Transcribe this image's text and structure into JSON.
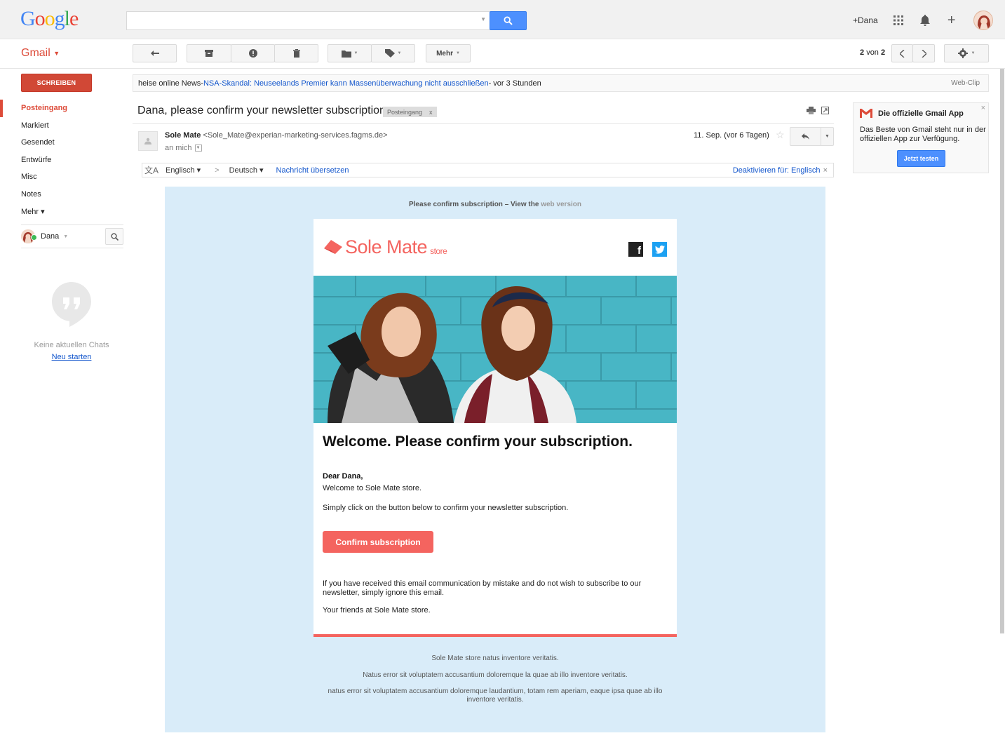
{
  "header": {
    "logo_letters": [
      "G",
      "o",
      "o",
      "g",
      "l",
      "e"
    ],
    "logo_colors": [
      "#4285f4",
      "#ea4335",
      "#fbbc05",
      "#4285f4",
      "#34a853",
      "#ea4335"
    ],
    "search": {
      "value": "",
      "placeholder": ""
    },
    "user_link": "+Dana",
    "icons": [
      "apps-grid-icon",
      "notifications-bell-icon",
      "share-plus-icon",
      "account-avatar"
    ]
  },
  "toolbar": {
    "gmail_label": "Gmail",
    "more_label": "Mehr",
    "pager_current": "2",
    "pager_of": "von",
    "pager_total": "2"
  },
  "sidebar": {
    "compose_label": "SCHREIBEN",
    "items": [
      {
        "label": "Posteingang",
        "active": true
      },
      {
        "label": "Markiert",
        "active": false
      },
      {
        "label": "Gesendet",
        "active": false
      },
      {
        "label": "Entwürfe",
        "active": false
      },
      {
        "label": "Misc",
        "active": false
      },
      {
        "label": "Notes",
        "active": false
      },
      {
        "label": "Mehr ▾",
        "active": false
      }
    ],
    "chat_user": "Dana",
    "no_chats": "Keine aktuellen Chats",
    "new_chat": "Neu starten"
  },
  "webclip": {
    "source": "heise online News",
    "separator": " - ",
    "headline": "NSA-Skandal: Neuseelands Premier kann Massenüberwachung nicht ausschließen",
    "time": " - vor 3 Stunden",
    "label": "Web-Clip"
  },
  "message": {
    "subject": "Dana, please confirm your newsletter subscription",
    "label_chip": "Posteingang",
    "label_remove": "x",
    "sender_name": "Sole Mate",
    "sender_email": "<Sole_Mate@experian-marketing-services.fagms.de>",
    "to": "an mich",
    "date": "11. Sep. (vor 6 Tagen)"
  },
  "translate": {
    "from_lang": "Englisch ▾",
    "arrow": ">",
    "to_lang": "Deutsch ▾",
    "translate_link": "Nachricht übersetzen",
    "disable_link": "Deaktivieren für: Englisch",
    "close": "×"
  },
  "email": {
    "preheader_main": "Please confirm subscription  – View the ",
    "preheader_link": "web version",
    "brand_name": "Sole Mate",
    "brand_suffix": "store",
    "facebook": "f",
    "heading": "Welcome. Please confirm your subscription.",
    "greeting": "Dear Dana,",
    "line1": "Welcome to Sole Mate store.",
    "line2": "Simply click on the button below to confirm your newsletter subscription.",
    "button": "Confirm subscription",
    "line3": "If you have received this email communication by mistake and do not wish to subscribe to our newsletter, simply ignore this email.",
    "line4": "Your friends at Sole Mate store.",
    "footer1": "Sole Mate store natus inventore veritatis.",
    "footer2": "Natus error sit voluptatem accusantium doloremque la quae ab illo inventore veritatis.",
    "footer3": "natus error sit voluptatem accusantium doloremque laudantium, totam rem aperiam, eaque ipsa quae ab illo inventore veritatis.",
    "accent": "#f4645f"
  },
  "promo": {
    "title": "Die offizielle Gmail App",
    "text": "Das Beste von Gmail steht nur in der offiziellen App zur Verfügung.",
    "button": "Jetzt testen",
    "close": "×"
  }
}
